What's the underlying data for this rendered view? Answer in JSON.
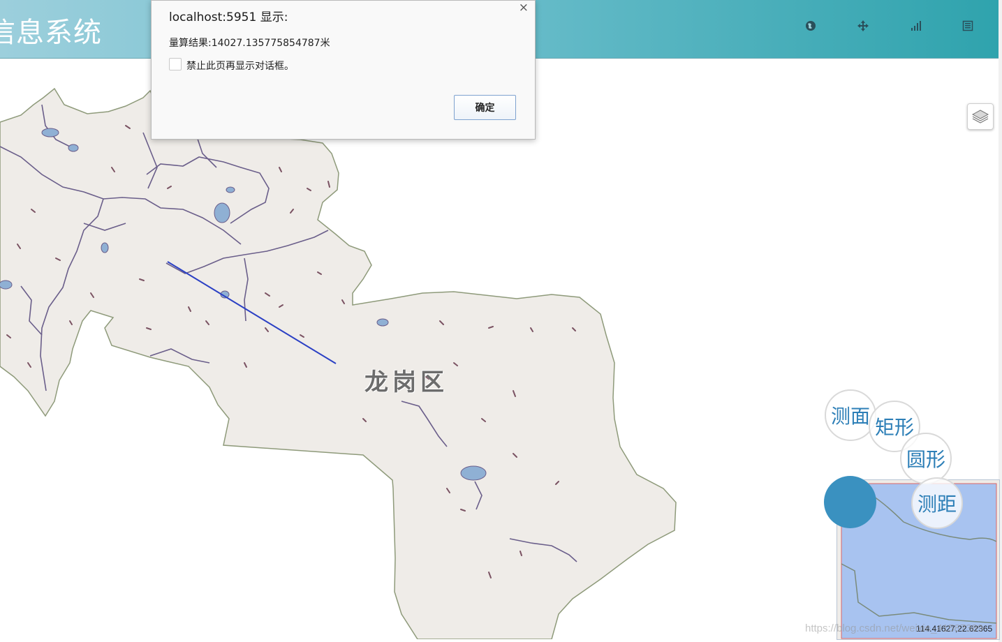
{
  "header": {
    "title": "信息系统",
    "icons": [
      "globe-icon",
      "move-icon",
      "signal-icon",
      "list-icon"
    ]
  },
  "map": {
    "district_label": "龙岗区",
    "coordinates": "114.41627,22.62365",
    "watermark": "https://blog.csdn.net/weixin_41587389"
  },
  "measure_menu": {
    "area": "测面",
    "rectangle": "矩形",
    "circle": "圆形",
    "distance": "测距"
  },
  "dialog": {
    "title": "localhost:5951 显示:",
    "message": "量算结果:14027.135775854787米",
    "checkbox_label": "禁止此页再显示对话框。",
    "ok_label": "确定",
    "close_symbol": "×"
  },
  "colors": {
    "land": "#efece8",
    "land_border": "#8e9a7a",
    "river": "#6a5e8a",
    "lake": "#8fb0d4",
    "measure_line": "#2b40c4",
    "fab": "#3a91c0"
  }
}
